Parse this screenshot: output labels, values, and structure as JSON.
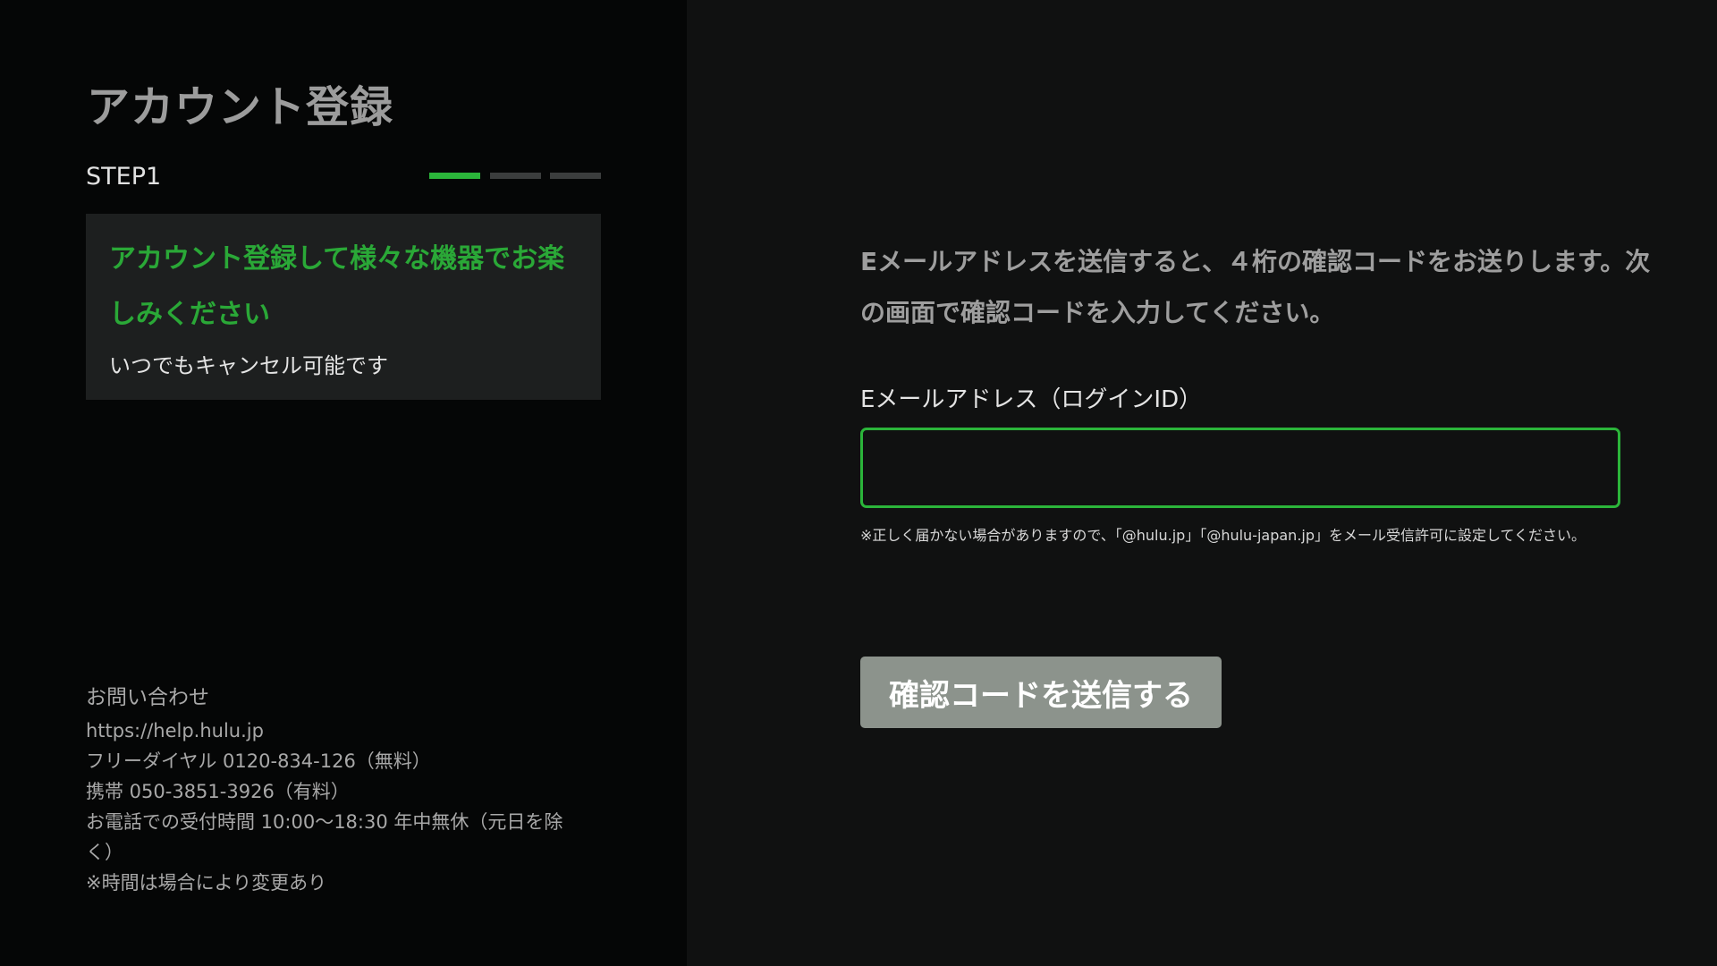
{
  "header": {
    "title": "アカウント登録",
    "step_label": "STEP1",
    "steps": {
      "total": 3,
      "current": 1
    }
  },
  "promo": {
    "headline": "アカウント登録して様々な機器でお楽しみください",
    "subtext": "いつでもキャンセル可能です"
  },
  "contact": {
    "title": "お問い合わせ",
    "lines": [
      "https://help.hulu.jp",
      "フリーダイヤル 0120-834-126（無料）",
      "携帯 050-3851-3926（有料）",
      "お電話での受付時間 10:00〜18:30 年中無休（元日を除く）",
      "※時間は場合により変更あり"
    ]
  },
  "form": {
    "instruction": "Eメールアドレスを送信すると、４桁の確認コードをお送りします。次の画面で確認コードを入力してください。",
    "email_label": "Eメールアドレス（ログインID）",
    "email_value": "",
    "note": "※正しく届かない場合がありますので、「@hulu.jp」「@hulu-japan.jp」をメール受信許可に設定してください。",
    "submit_label": "確認コードを送信する"
  },
  "colors": {
    "accent": "#2bb53a",
    "button_bg": "#8c938c",
    "left_bg": "#050606",
    "right_bg": "#101111"
  }
}
